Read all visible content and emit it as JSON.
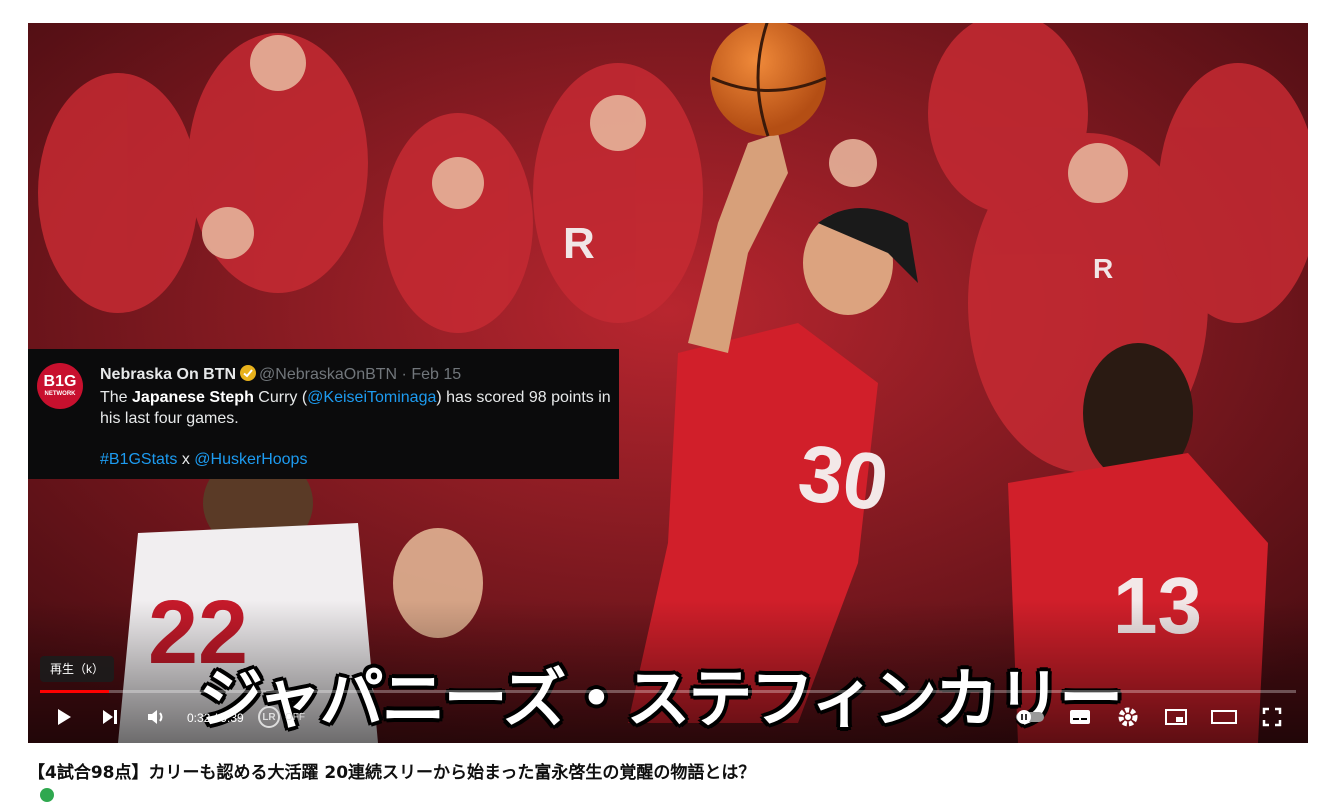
{
  "tweet": {
    "logo_big": "B1G",
    "logo_small": "NETWORK",
    "name": "Nebraska On BTN",
    "handle": "@NebraskaOnBTN · Feb 15",
    "body_pre": "The ",
    "body_bold": "Japanese Steph",
    "body_mid": " Curry (",
    "body_link": "@KeiseiTominaga",
    "body_post": ") has scored 98 points in his last four games.",
    "tag1": "#B1GStats",
    "tag_sep": " x ",
    "tag2": "@HuskerHoops"
  },
  "video": {
    "caption": "ジャパニーズ・ステフィンカリー",
    "tooltip": "再生（k）",
    "time": "0:32 / 9:39",
    "progress": 0.055,
    "speed_badge": "LR",
    "speed_state": "OFF"
  },
  "page": {
    "title": "【4試合98点】カリーも認める大活躍 20連続スリーから始まった富永啓生の覚醒の物語とは？"
  },
  "colors": {
    "progress": "#ff0000",
    "jersey_red": "#d11f2a",
    "link": "#1d9bf0"
  },
  "icons": [
    "play-icon",
    "next-icon",
    "volume-icon",
    "autoplay-toggle-icon",
    "subtitles-icon",
    "settings-icon",
    "miniplayer-icon",
    "theater-icon",
    "fullscreen-icon"
  ]
}
